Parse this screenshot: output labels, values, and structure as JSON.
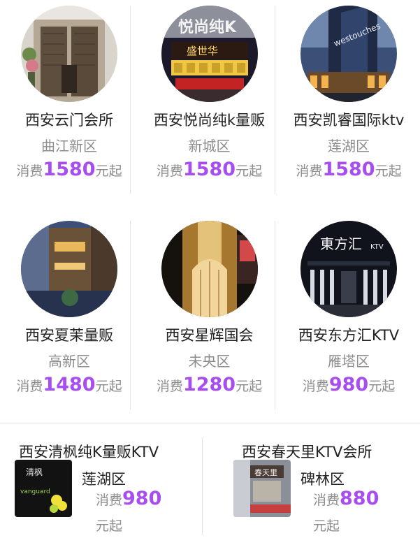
{
  "venues": [
    {
      "name": "西安云门会所",
      "area": "曲江新区",
      "price_prefix": "消费",
      "price": "1580",
      "price_suffix": "元起"
    },
    {
      "name": "西安悦尚纯k量贩",
      "area": "新城区",
      "price_prefix": "消费",
      "price": "1580",
      "price_suffix": "元起"
    },
    {
      "name": "西安凯睿国际ktv",
      "area": "莲湖区",
      "price_prefix": "消费",
      "price": "1580",
      "price_suffix": "元起"
    },
    {
      "name": "西安夏茉量贩",
      "area": "高新区",
      "price_prefix": "消费",
      "price": "1480",
      "price_suffix": "元起"
    },
    {
      "name": "西安星辉国会",
      "area": "未央区",
      "price_prefix": "消费",
      "price": "1280",
      "price_suffix": "元起"
    },
    {
      "name": "西安东方汇KTV",
      "area": "雁塔区",
      "price_prefix": "消费",
      "price": "980",
      "price_suffix": "元起"
    }
  ],
  "bottom_venues": [
    {
      "name": "西安清枫纯K量贩KTV",
      "area": "莲湖区",
      "price_prefix": "消费",
      "price": "980",
      "price_suffix": "元起"
    },
    {
      "name": "西安春天里KTV会所",
      "area": "碑林区",
      "price_prefix": "消费",
      "price": "880",
      "price_suffix": "元起"
    }
  ],
  "photo_signs": {
    "v1": "悦尚纯K",
    "v1b": "盛世华",
    "v2": "westouches",
    "v5": "東方汇",
    "v5b": "KTV",
    "b0": "清枫",
    "b0b": "vanguard",
    "b1": "春天里"
  },
  "colors": {
    "accent": "#a84ef0",
    "muted": "#8d8d8d",
    "text": "#222222"
  }
}
